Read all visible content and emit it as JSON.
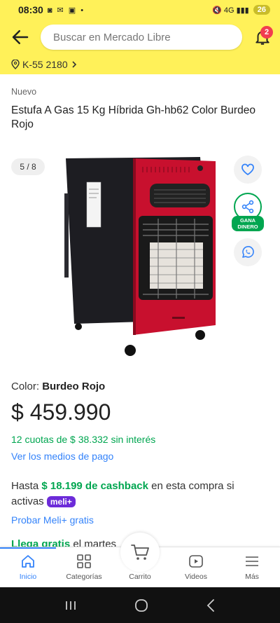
{
  "status": {
    "time": "08:30",
    "battery": "26"
  },
  "header": {
    "search_placeholder": "Buscar en Mercado Libre",
    "notifications_count": "2",
    "address": "K-55 2180"
  },
  "product": {
    "condition": "Nuevo",
    "title": "Estufa A Gas 15 Kg Híbrida Gh-hb62 Color Burdeo Rojo",
    "image_counter": "5 / 8",
    "share_badge": "GANA\nDINERO",
    "color_label": "Color: ",
    "color_value": "Burdeo Rojo",
    "price": "$ 459.990",
    "installments": "12 cuotas de $ 38.332 sin interés",
    "payment_link": "Ver los medios de pago",
    "cashback_prefix": "Hasta ",
    "cashback_amount": "$ 18.199 de cashback",
    "cashback_suffix": " en esta compra si activas ",
    "meli_badge": "meli+",
    "meli_link": "Probar Meli+ gratis",
    "arrival_highlight": "Llega gratis",
    "arrival_text": " el martes"
  },
  "tabs": [
    {
      "label": "Inicio",
      "icon": "home-icon",
      "active": true
    },
    {
      "label": "Categorías",
      "icon": "grid-icon"
    },
    {
      "label": "Carrito",
      "icon": "cart-icon"
    },
    {
      "label": "Videos",
      "icon": "play-icon"
    },
    {
      "label": "Más",
      "icon": "menu-icon"
    }
  ],
  "colors": {
    "header_yellow": "#fff159",
    "link_blue": "#3483fa",
    "green": "#00a650",
    "heater_red": "#c8102e"
  }
}
